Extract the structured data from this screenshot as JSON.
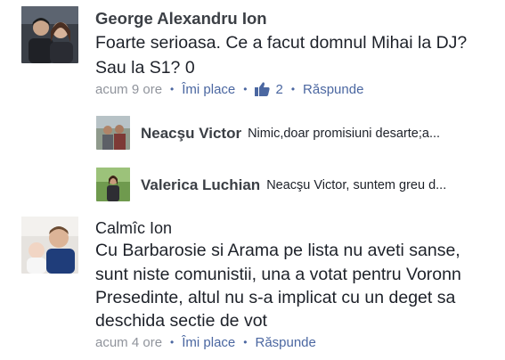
{
  "comments": [
    {
      "author": "George Alexandru Ion",
      "lines": [
        "Foarte serioasa. Ce a facut domnul Mihai la DJ?",
        "Sau la S1? 0"
      ],
      "time": "acum 9 ore",
      "like_action": "Îmi place",
      "reaction_count": "2",
      "reply_action": "Răspunde",
      "replies": [
        {
          "author": "Neacşu Victor",
          "snippet": "Nimic,doar promisiuni desarte;a..."
        },
        {
          "author": "Valerica Luchian",
          "snippet": "Neacşu Victor, suntem greu d..."
        }
      ]
    },
    {
      "author": "Calmîc Ion",
      "lines": [
        "Cu Barbarosie si  Arama pe lista nu aveti sanse,",
        "sunt niste comunistii, una a votat pentru Voronn",
        "Presedinte, altul nu s-a implicat cu un deget sa",
        "deschida sectie de vot"
      ],
      "time": "acum 4 ore",
      "like_action": "Îmi place",
      "reply_action": "Răspunde"
    }
  ],
  "colors": {
    "link": "#4b67a1",
    "meta": "#90949c",
    "text": "#1d2129",
    "author": "#3b3f45"
  }
}
